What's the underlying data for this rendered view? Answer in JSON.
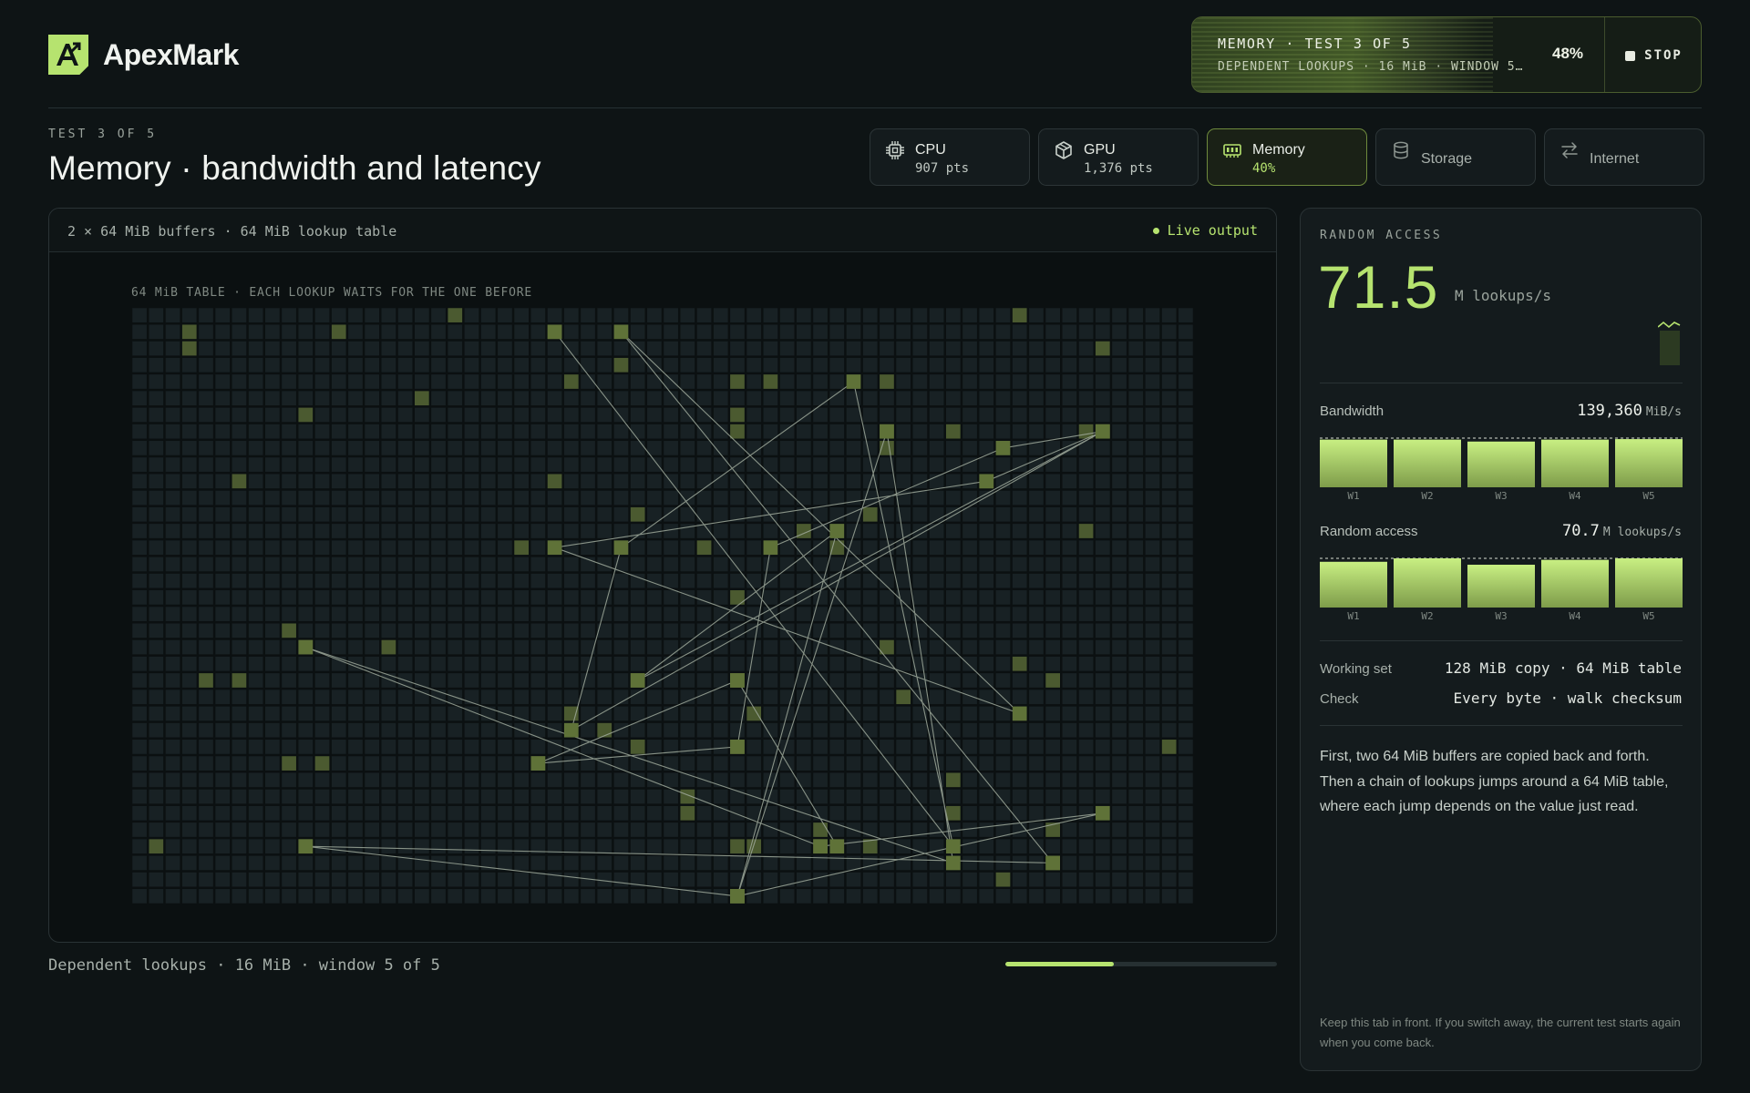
{
  "app": {
    "name": "ApexMark",
    "logo_icon": "apexmark-logo-icon"
  },
  "run": {
    "title": "MEMORY · TEST 3 OF 5",
    "subtitle": "DEPENDENT LOOKUPS · 16 MiB · WINDOW 5 O…",
    "percent": "48%",
    "stop_label": "STOP"
  },
  "page": {
    "eyebrow": "TEST 3 OF 5",
    "title": "Memory · bandwidth and latency"
  },
  "tabs": [
    {
      "label": "CPU",
      "sub": "907 pts",
      "icon": "cpu-icon",
      "active": false
    },
    {
      "label": "GPU",
      "sub": "1,376 pts",
      "icon": "cube-icon",
      "active": false
    },
    {
      "label": "Memory",
      "sub": "40%",
      "icon": "memory-icon",
      "active": true
    },
    {
      "label": "Storage",
      "sub": "",
      "icon": "database-icon",
      "active": false
    },
    {
      "label": "Internet",
      "sub": "",
      "icon": "transfer-arrows-icon",
      "active": false
    }
  ],
  "viz": {
    "header_left": "2 × 64 MiB buffers · 64 MiB lookup table",
    "live_label": "Live output",
    "grid_caption": "64 MiB TABLE · EACH LOOKUP WAITS FOR THE ONE BEFORE",
    "grid": {
      "cols": 64,
      "rows": 36,
      "highlighted": [
        [
          3,
          1
        ],
        [
          12,
          1
        ],
        [
          19,
          0
        ],
        [
          25,
          1
        ],
        [
          53,
          0
        ],
        [
          3,
          2
        ],
        [
          58,
          2
        ],
        [
          29,
          3
        ],
        [
          26,
          4
        ],
        [
          36,
          4
        ],
        [
          38,
          4
        ],
        [
          45,
          4
        ],
        [
          17,
          5
        ],
        [
          10,
          6
        ],
        [
          36,
          6
        ],
        [
          36,
          7
        ],
        [
          45,
          7
        ],
        [
          57,
          7
        ],
        [
          49,
          7
        ],
        [
          45,
          8
        ],
        [
          6,
          10
        ],
        [
          25,
          10
        ],
        [
          51,
          10
        ],
        [
          30,
          12
        ],
        [
          44,
          12
        ],
        [
          40,
          13
        ],
        [
          34,
          14
        ],
        [
          42,
          14
        ],
        [
          57,
          13
        ],
        [
          23,
          14
        ],
        [
          36,
          17
        ],
        [
          9,
          19
        ],
        [
          10,
          20
        ],
        [
          15,
          20
        ],
        [
          45,
          20
        ],
        [
          4,
          22
        ],
        [
          6,
          22
        ],
        [
          53,
          21
        ],
        [
          30,
          22
        ],
        [
          55,
          22
        ],
        [
          26,
          24
        ],
        [
          37,
          24
        ],
        [
          46,
          23
        ],
        [
          30,
          26
        ],
        [
          28,
          25
        ],
        [
          62,
          26
        ],
        [
          36,
          26
        ],
        [
          9,
          27
        ],
        [
          11,
          27
        ],
        [
          24,
          27
        ],
        [
          49,
          28
        ],
        [
          33,
          29
        ],
        [
          33,
          30
        ],
        [
          49,
          30
        ],
        [
          41,
          31
        ],
        [
          55,
          31
        ],
        [
          1,
          32
        ],
        [
          10,
          32
        ],
        [
          36,
          32
        ],
        [
          44,
          32
        ],
        [
          41,
          32
        ],
        [
          37,
          32
        ],
        [
          55,
          33
        ],
        [
          52,
          34
        ],
        [
          36,
          35
        ]
      ],
      "path": [
        [
          25,
          1
        ],
        [
          49,
          32
        ],
        [
          43,
          4
        ],
        [
          29,
          14
        ],
        [
          26,
          25
        ],
        [
          58,
          7
        ],
        [
          51,
          10
        ],
        [
          25,
          14
        ],
        [
          53,
          24
        ],
        [
          29,
          1
        ],
        [
          55,
          33
        ],
        [
          10,
          32
        ],
        [
          36,
          35
        ],
        [
          58,
          30
        ],
        [
          41,
          32
        ],
        [
          10,
          20
        ],
        [
          49,
          33
        ],
        [
          45,
          7
        ],
        [
          36,
          35
        ],
        [
          42,
          13
        ],
        [
          30,
          22
        ],
        [
          58,
          7
        ],
        [
          52,
          8
        ],
        [
          38,
          14
        ],
        [
          36,
          26
        ],
        [
          24,
          27
        ],
        [
          36,
          22
        ],
        [
          42,
          32
        ],
        [
          36,
          22
        ]
      ]
    },
    "bottom_caption": "Dependent lookups · 16 MiB · window 5 of 5",
    "progress": 0.4
  },
  "side": {
    "eyebrow": "RANDOM ACCESS",
    "big_value": "71.5",
    "big_unit": "M lookups/s",
    "bandwidth": {
      "label": "Bandwidth",
      "value": "139,360",
      "unit": "MiB/s",
      "windows": [
        "W1",
        "W2",
        "W3",
        "W4",
        "W5"
      ],
      "values": [
        0.97,
        0.97,
        0.93,
        0.97,
        0.98
      ]
    },
    "random_access": {
      "label": "Random access",
      "value": "70.7",
      "unit": "M lookups/s",
      "windows": [
        "W1",
        "W2",
        "W3",
        "W4",
        "W5"
      ],
      "values": [
        0.93,
        1.0,
        0.87,
        0.97,
        1.0
      ]
    },
    "working_set": {
      "label": "Working set",
      "value": "128 MiB copy · 64 MiB table"
    },
    "check": {
      "label": "Check",
      "value": "Every byte · walk checksum"
    },
    "description": "First, two 64 MiB buffers are copied back and forth. Then a chain of lookups jumps around a 64 MiB table, where each jump depends on the value just read.",
    "footnote": "Keep this tab in front. If you switch away, the current test starts again when you come back."
  },
  "colors": {
    "accent": "#b6e36f",
    "background": "#0e1415",
    "panel": "#141b1d"
  }
}
